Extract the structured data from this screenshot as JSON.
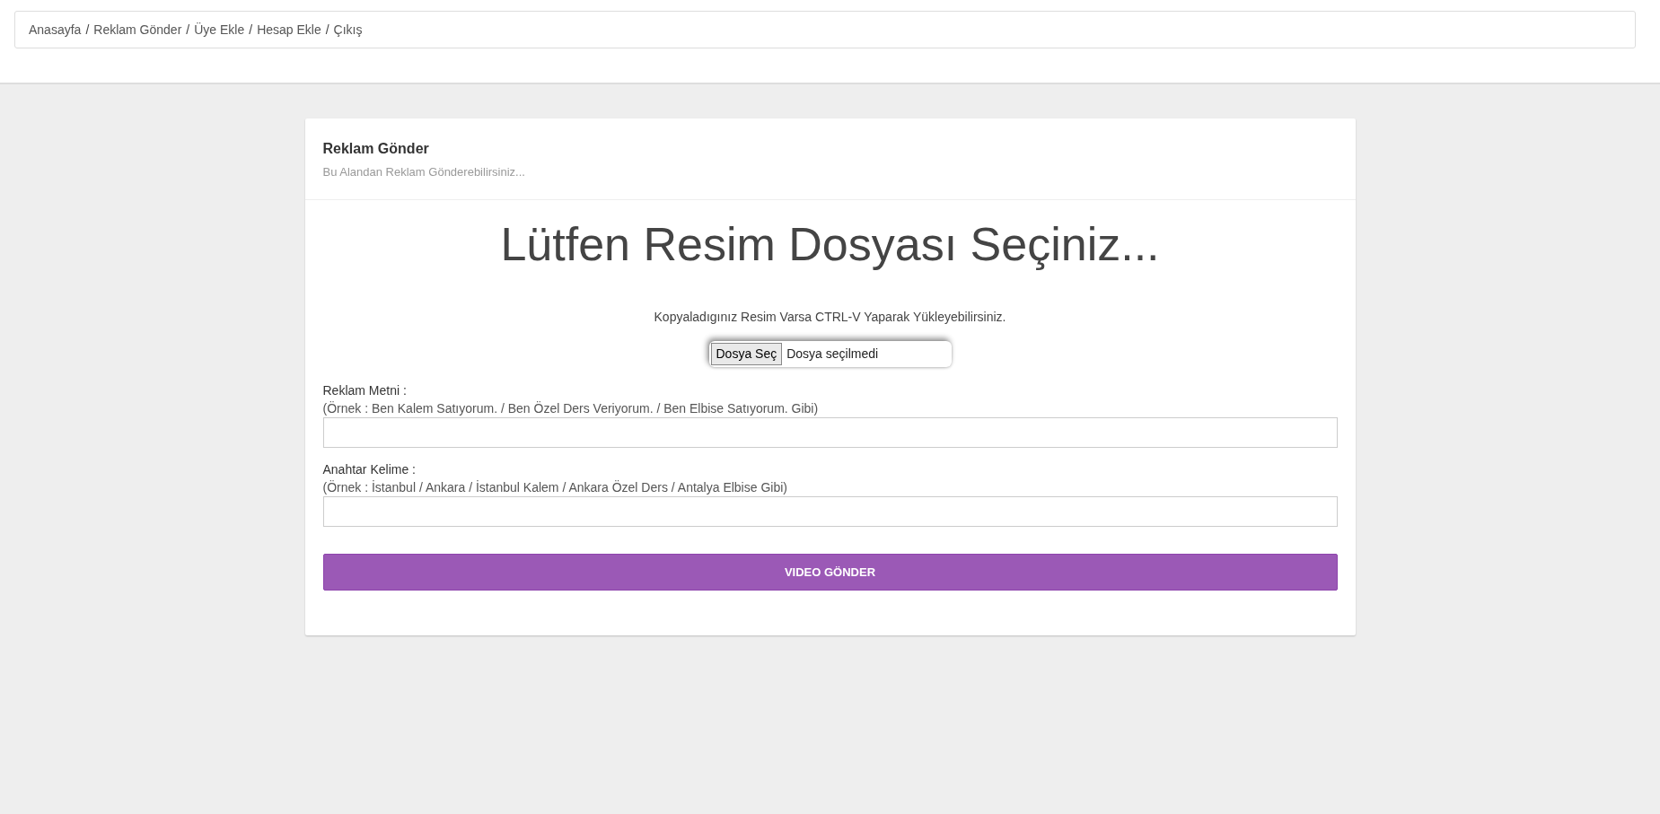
{
  "breadcrumb": {
    "separator": "/",
    "items": [
      {
        "label": "Anasayfa"
      },
      {
        "label": "Reklam Gönder"
      },
      {
        "label": "Üye Ekle"
      },
      {
        "label": "Hesap Ekle"
      },
      {
        "label": "Çıkış"
      }
    ]
  },
  "card": {
    "title": "Reklam Gönder",
    "subtitle": "Bu Alandan Reklam Gönderebilirsiniz...",
    "heading": "Lütfen Resim Dosyası Seçiniz...",
    "paste_hint": "Kopyaladıgınız Resim Varsa CTRL-V Yaparak Yükleyebilirsiniz.",
    "file_input": {
      "button": "Dosya Seç",
      "status": "Dosya seçilmedi"
    },
    "fields": [
      {
        "label": "Reklam Metni :",
        "hint": "(Örnek : Ben Kalem Satıyorum. / Ben Özel Ders Veriyorum. / Ben Elbise Satıyorum. Gibi)"
      },
      {
        "label": "Anahtar Kelime :",
        "hint": "(Örnek : İstanbul / Ankara / İstanbul Kalem / Ankara Özel Ders / Antalya Elbise Gibi)"
      }
    ],
    "submit": "VIDEO GÖNDER"
  }
}
